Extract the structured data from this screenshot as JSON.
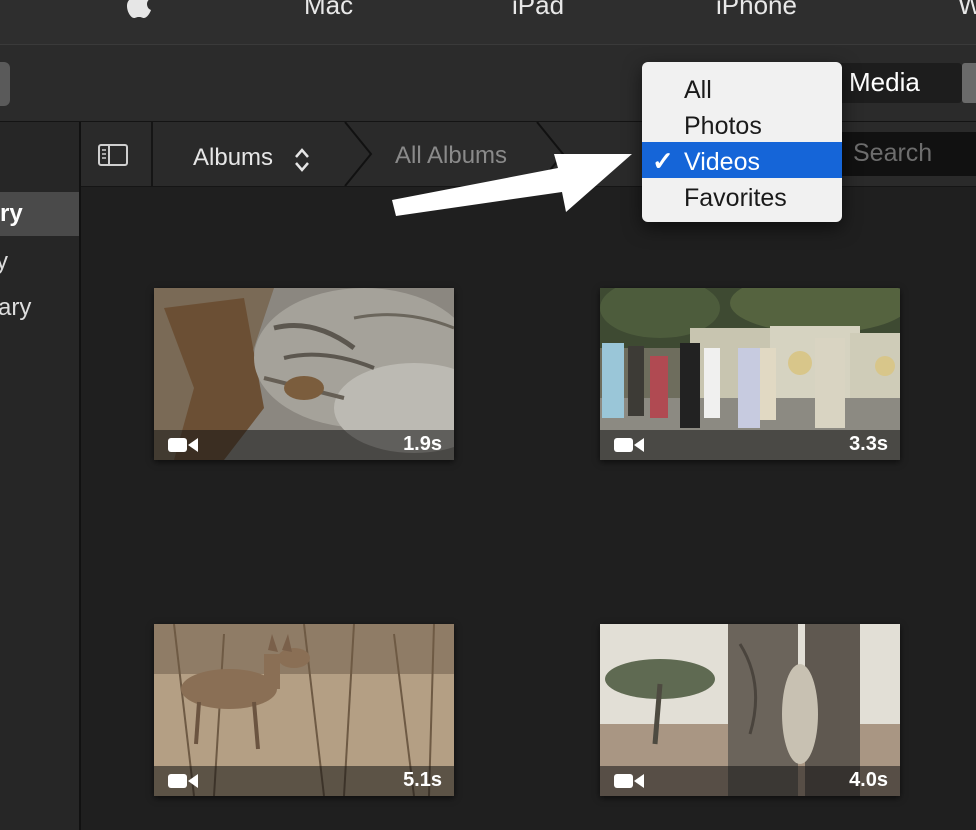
{
  "topnav": {
    "items": [
      "Mac",
      "iPad",
      "iPhone",
      "W"
    ]
  },
  "toolbar": {
    "media_label": "Media"
  },
  "sidebar": {
    "items": [
      "ry",
      "y",
      "ary"
    ]
  },
  "browser": {
    "albums_label": "Albums",
    "all_albums_label": "All Albums",
    "search_placeholder": "Search"
  },
  "filter_menu": {
    "items": [
      {
        "label": "All",
        "checked": false
      },
      {
        "label": "Photos",
        "checked": false
      },
      {
        "label": "Videos",
        "checked": true
      },
      {
        "label": "Favorites",
        "checked": false
      }
    ],
    "check_glyph": "✓"
  },
  "clips": [
    {
      "duration": "1.9s",
      "icon": "video-camera-icon"
    },
    {
      "duration": "3.3s",
      "icon": "video-camera-icon"
    },
    {
      "duration": "5.1s",
      "icon": "video-camera-icon"
    },
    {
      "duration": "4.0s",
      "icon": "video-camera-icon"
    }
  ],
  "colors": {
    "selection": "#1565d8",
    "background": "#1f1f1f"
  }
}
